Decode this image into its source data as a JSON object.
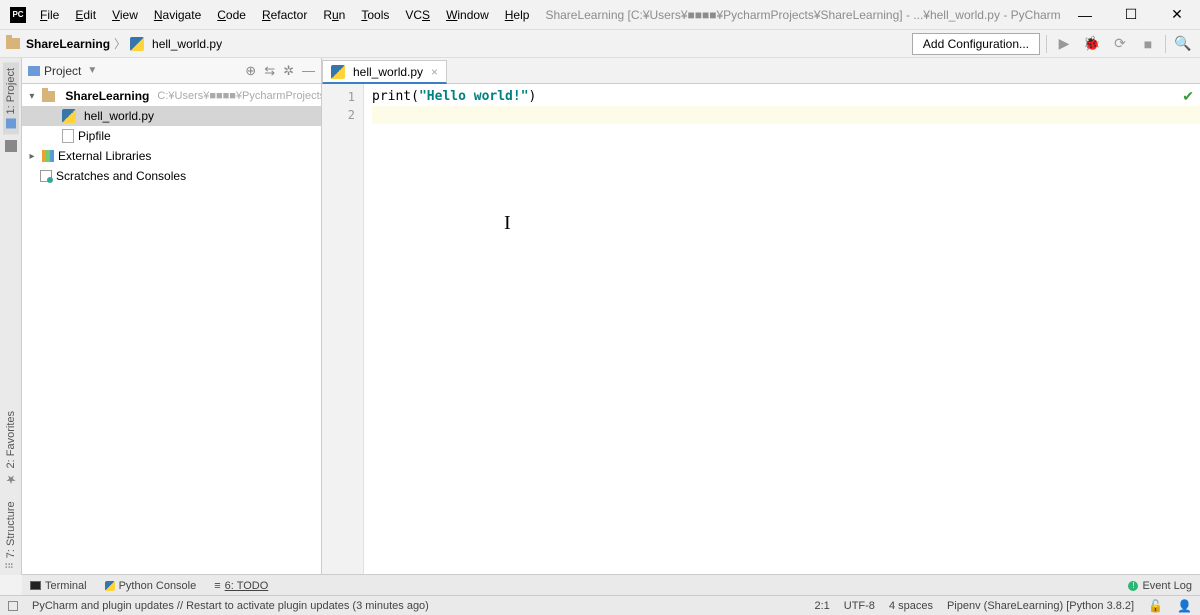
{
  "menu": {
    "items": [
      "File",
      "Edit",
      "View",
      "Navigate",
      "Code",
      "Refactor",
      "Run",
      "Tools",
      "VCS",
      "Window",
      "Help"
    ]
  },
  "title": "ShareLearning [C:¥Users¥■■■■¥PycharmProjects¥ShareLearning] - ...¥hell_world.py - PyCharm",
  "breadcrumb": {
    "project": "ShareLearning",
    "file": "hell_world.py"
  },
  "toolbar": {
    "add_config": "Add Configuration..."
  },
  "left_gutter": {
    "project": "1: Project",
    "favorites": "2: Favorites",
    "structure": "7: Structure"
  },
  "project_panel": {
    "title": "Project",
    "root": {
      "name": "ShareLearning",
      "path": "C:¥Users¥■■■■¥PycharmProjects"
    },
    "files": [
      "hell_world.py",
      "Pipfile"
    ],
    "external": "External Libraries",
    "scratches": "Scratches and Consoles"
  },
  "editor": {
    "tab": "hell_world.py",
    "lines": [
      "1",
      "2"
    ],
    "code_plain": "print(\"Hello world!\")"
  },
  "bottom": {
    "terminal": "Terminal",
    "python_console": "Python Console",
    "todo": "6: TODO",
    "event_log": "Event Log"
  },
  "status": {
    "message": "PyCharm and plugin updates // Restart to activate plugin updates (3 minutes ago)",
    "pos": "2:1",
    "encoding": "UTF-8",
    "indent": "4 spaces",
    "interpreter": "Pipenv (ShareLearning) [Python 3.8.2]"
  }
}
